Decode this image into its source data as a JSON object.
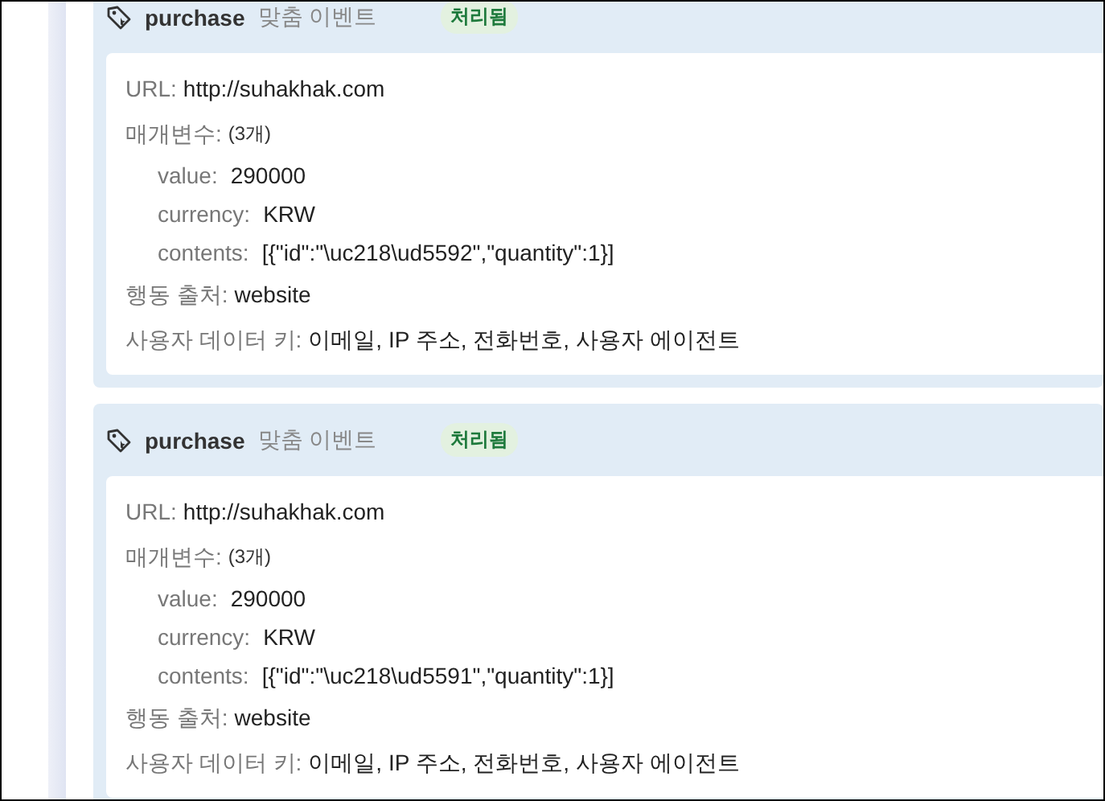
{
  "events": [
    {
      "name": "purchase",
      "type": "맞춤 이벤트",
      "status": {
        "label": "처리됨",
        "kind": "processed"
      },
      "fields": {
        "url_label": "URL:",
        "url": "http://suhakhak.com",
        "params_label": "매개변수:",
        "params_count": "(3개)",
        "source_label": "행동 출처:",
        "source": "website",
        "user_data_label": "사용자 데이터 키:",
        "user_data": "이메일, IP 주소, 전화번호, 사용자 에이전트"
      },
      "params": [
        {
          "key": "value:",
          "value": "290000"
        },
        {
          "key": "currency:",
          "value": "KRW"
        },
        {
          "key": "contents:",
          "value": "[{\"id\":\"\\uc218\\ud5592\",\"quantity\":1}]"
        }
      ]
    },
    {
      "name": "purchase",
      "type": "맞춤 이벤트",
      "status": {
        "label": "처리됨",
        "kind": "processed"
      },
      "fields": {
        "url_label": "URL:",
        "url": "http://suhakhak.com",
        "params_label": "매개변수:",
        "params_count": "(3개)",
        "source_label": "행동 출처:",
        "source": "website",
        "user_data_label": "사용자 데이터 키:",
        "user_data": "이메일, IP 주소, 전화번호, 사용자 에이전트"
      },
      "params": [
        {
          "key": "value:",
          "value": "290000"
        },
        {
          "key": "currency:",
          "value": "KRW"
        },
        {
          "key": "contents:",
          "value": "[{\"id\":\"\\uc218\\ud5591\",\"quantity\":1}]"
        }
      ]
    }
  ]
}
